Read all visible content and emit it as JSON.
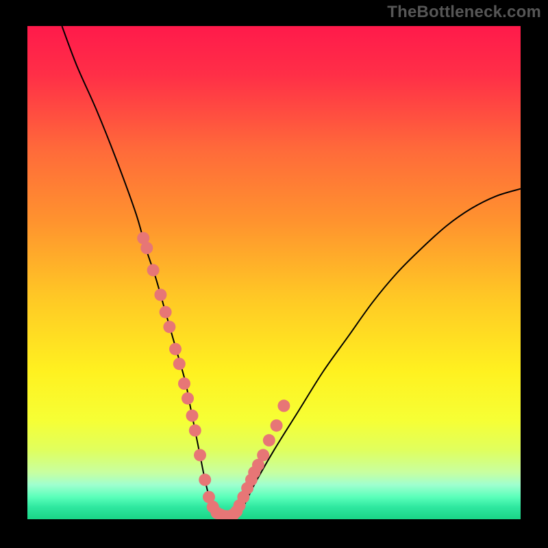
{
  "watermark": "TheBottleneck.com",
  "chart_data": {
    "type": "line",
    "title": "",
    "xlabel": "",
    "ylabel": "",
    "xlim": [
      0,
      100
    ],
    "ylim": [
      0,
      100
    ],
    "background_gradient_stops": [
      {
        "offset": 0.0,
        "color": "#ff1a4b"
      },
      {
        "offset": 0.1,
        "color": "#ff2f47"
      },
      {
        "offset": 0.25,
        "color": "#ff6a3a"
      },
      {
        "offset": 0.4,
        "color": "#ff942e"
      },
      {
        "offset": 0.55,
        "color": "#ffc825"
      },
      {
        "offset": 0.7,
        "color": "#fff120"
      },
      {
        "offset": 0.8,
        "color": "#f6ff35"
      },
      {
        "offset": 0.86,
        "color": "#e0ff5e"
      },
      {
        "offset": 0.905,
        "color": "#c8ffa0"
      },
      {
        "offset": 0.93,
        "color": "#a0ffcf"
      },
      {
        "offset": 0.955,
        "color": "#5affba"
      },
      {
        "offset": 0.975,
        "color": "#2fe8a0"
      },
      {
        "offset": 1.0,
        "color": "#1ad687"
      }
    ],
    "series": [
      {
        "name": "bottleneck-curve",
        "color": "#000000",
        "stroke_width": 2,
        "x": [
          7,
          10,
          14,
          18,
          22,
          24,
          26,
          28,
          30,
          32,
          33,
          34,
          35,
          36,
          37,
          38,
          39.5,
          41,
          42.5,
          44,
          46,
          50,
          55,
          60,
          65,
          70,
          75,
          80,
          85,
          90,
          95,
          100
        ],
        "y": [
          100,
          92,
          83,
          73,
          62,
          55,
          49,
          42,
          35,
          28,
          23,
          18,
          13,
          8,
          4,
          1.5,
          0.7,
          0.6,
          1.2,
          3,
          7,
          14,
          22,
          30,
          37,
          44,
          50,
          55,
          59.5,
          63,
          65.5,
          67
        ]
      },
      {
        "name": "data-markers",
        "color": "#e77676",
        "type": "scatter",
        "marker_radius": 4.2,
        "x": [
          23.5,
          24.2,
          25.5,
          27.0,
          28.0,
          28.8,
          30.0,
          30.8,
          31.8,
          32.5,
          33.4,
          34.0,
          35.0,
          36.0,
          36.8,
          37.6,
          38.4,
          39.2,
          40.2,
          41.0,
          41.8,
          42.4,
          43.0,
          43.8,
          44.6,
          45.4,
          46.0,
          46.8,
          47.8,
          49.0,
          50.5,
          52.0
        ],
        "y": [
          57.0,
          55.0,
          50.5,
          45.5,
          42.0,
          39.0,
          34.5,
          31.5,
          27.5,
          24.5,
          21.0,
          18.0,
          13.0,
          8.0,
          4.5,
          2.5,
          1.3,
          0.9,
          0.6,
          0.6,
          1.0,
          1.6,
          2.8,
          4.5,
          6.3,
          8.0,
          9.5,
          11.0,
          13.0,
          16.0,
          19.0,
          23.0
        ]
      }
    ]
  }
}
